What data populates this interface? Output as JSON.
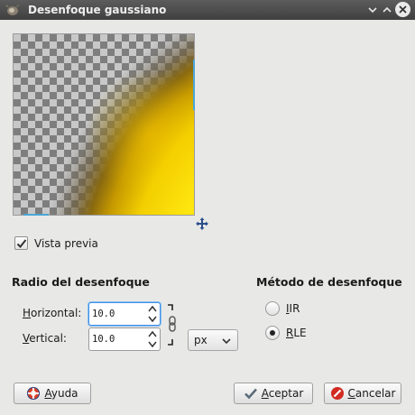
{
  "window": {
    "title": "Desenfoque gaussiano",
    "icon": "gimp-icon",
    "controls": [
      "minimize-icon",
      "maximize-icon",
      "close-icon"
    ]
  },
  "preview": {
    "checkbox_label": "Vista previa",
    "checked": true
  },
  "blur_radius": {
    "title": "Radio del desenfoque",
    "horizontal": {
      "label": "Horizontal:",
      "mnemonic": "H",
      "label_rest": "orizontal:",
      "value": "10.0"
    },
    "vertical": {
      "label": "Vertical:",
      "mnemonic": "V",
      "label_rest": "ertical:",
      "value": "10.0"
    },
    "chain_linked": true,
    "unit": "px"
  },
  "blur_method": {
    "title": "Método de desenfoque",
    "options": [
      {
        "label": "IIR",
        "mnemonic": "I",
        "label_rest": "IR",
        "selected": false
      },
      {
        "label": "RLE",
        "mnemonic": "R",
        "label_rest": "LE",
        "selected": true
      }
    ]
  },
  "buttons": {
    "help": {
      "label": "Ayuda",
      "mnemonic": "A",
      "label_rest": "yuda",
      "icon": "help-lifebuoy-icon"
    },
    "ok": {
      "label": "Aceptar",
      "mnemonic": "A",
      "label_rest": "ceptar",
      "icon": "checkmark-icon"
    },
    "cancel": {
      "label": "Cancelar",
      "mnemonic": "C",
      "label_rest": "ancelar",
      "icon": "cancel-icon"
    }
  },
  "colors": {
    "accent_blue": "#3d8ee6",
    "ruler_blue": "#4aa6d8",
    "yellow_light": "#ffe81a",
    "yellow_dark": "#c89c00",
    "cancel_red": "#d22b22"
  }
}
